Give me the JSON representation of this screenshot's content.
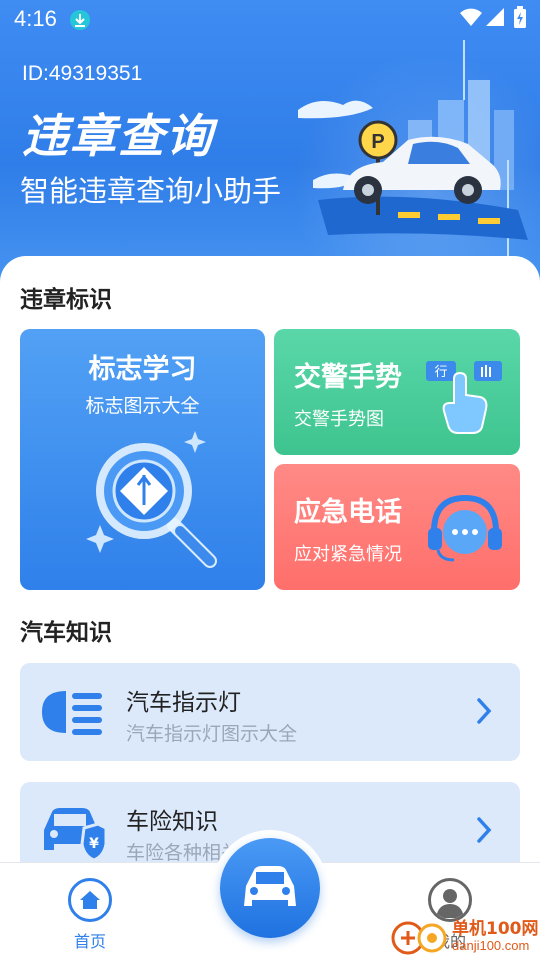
{
  "status_bar": {
    "time": "4:16"
  },
  "hero": {
    "user_id": "ID:49319351",
    "title": "违章查询",
    "subtitle": "智能违章查询小助手",
    "parking_sign": "P"
  },
  "section_violation": {
    "title": "违章标识"
  },
  "cards": {
    "learn": {
      "title": "标志学习",
      "subtitle": "标志图示大全"
    },
    "gesture": {
      "title": "交警手势",
      "subtitle": "交警手势图",
      "sign_text": "行"
    },
    "emergency": {
      "title": "应急电话",
      "subtitle": "应对紧急情况"
    }
  },
  "section_car": {
    "title": "汽车知识"
  },
  "list": [
    {
      "title": "汽车指示灯",
      "subtitle": "汽车指示灯图示大全",
      "icon": "headlight-icon"
    },
    {
      "title": "车险知识",
      "subtitle": "车险各种相关",
      "icon": "car-insurance-icon",
      "badge": "¥"
    }
  ],
  "bottom_nav": {
    "home_label": "首页",
    "center_icon": "car-icon",
    "mine_label": "我的"
  },
  "watermark": {
    "text": "单机100网",
    "url": "danji100.com"
  },
  "colors": {
    "primary": "#2f80ea",
    "green": "#3ec48f",
    "red": "#ff6f6b",
    "list_bg": "#dce9fb"
  }
}
